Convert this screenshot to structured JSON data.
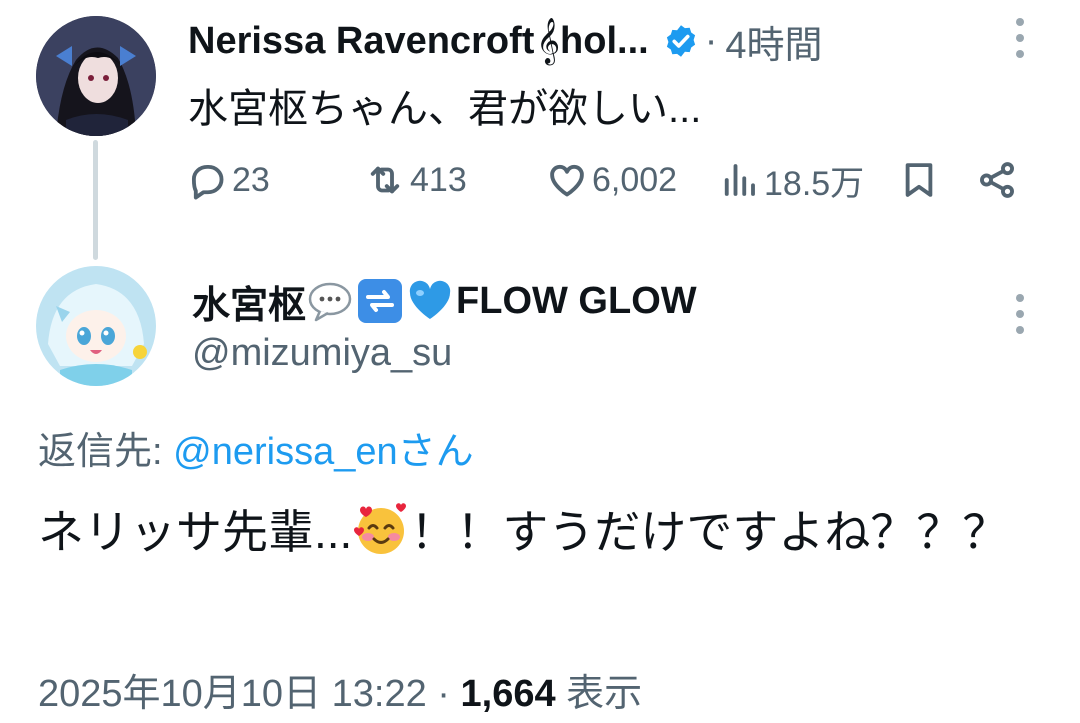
{
  "parent_tweet": {
    "display_name": "Nerissa Ravencroft",
    "name_emoji": "𝄞",
    "name_suffix": "hol...",
    "separator": "·",
    "time": "4時間",
    "text": "水宮枢ちゃん、君が欲しい...",
    "stats": {
      "replies": "23",
      "reposts": "413",
      "likes": "6,002",
      "views": "18.5万"
    }
  },
  "reply_tweet": {
    "display_name": "水宮枢",
    "name_suffix": "FLOW GLOW",
    "name_emojis": [
      "speech-bubble",
      "repeat-button",
      "blue-heart"
    ],
    "handle": "@mizumiya_su",
    "reply_label": "返信先:",
    "reply_mention": "@nerissa_enさん",
    "text_part1": "ネリッサ先輩...",
    "text_part2": "！！すうだけですよね？？？",
    "timestamp": "2025年10月10日 13:22",
    "dot": "·",
    "view_count": "1,664",
    "view_label": "表示"
  },
  "colors": {
    "accent": "#1d9bf0",
    "secondary_text": "#536471",
    "primary_text": "#0f1419",
    "thread_line": "#cfd9de"
  },
  "icons": [
    "reply-icon",
    "repost-icon",
    "like-icon",
    "views-icon",
    "bookmark-icon",
    "share-icon",
    "verified-badge-icon",
    "more-icon"
  ]
}
